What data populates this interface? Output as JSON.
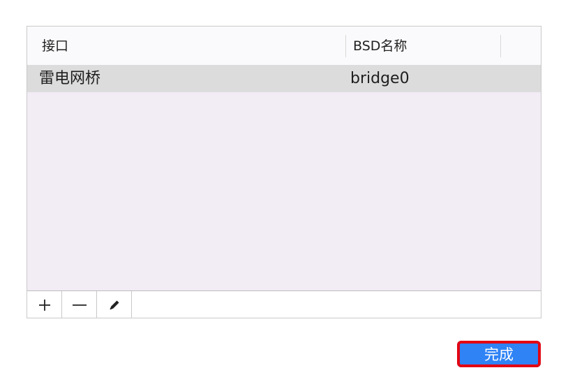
{
  "table": {
    "columns": [
      {
        "label": "接口"
      },
      {
        "label": "BSD名称"
      }
    ],
    "rows": [
      {
        "interface": "雷电网桥",
        "bsd_name": "bridge0"
      }
    ]
  },
  "toolbar": {
    "add_icon": "plus-icon",
    "remove_icon": "minus-icon",
    "edit_icon": "pencil-icon"
  },
  "actions": {
    "done_label": "完成"
  },
  "colors": {
    "accent": "#2f83f5",
    "highlight_border": "#e30613",
    "table_background": "#f2ecf5",
    "selected_row": "#dcdcdc"
  }
}
